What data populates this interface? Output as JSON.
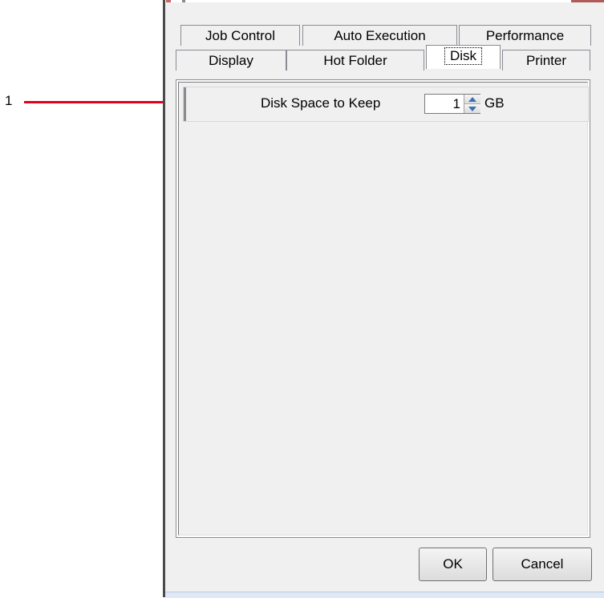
{
  "callout": {
    "number": "1",
    "color": "#e2001a"
  },
  "tabs": {
    "row1": [
      {
        "label": "Job Control"
      },
      {
        "label": "Auto Execution"
      },
      {
        "label": "Performance"
      }
    ],
    "row2": [
      {
        "label": "Display"
      },
      {
        "label": "Hot Folder"
      },
      {
        "label": "Disk",
        "selected": true
      },
      {
        "label": "Printer"
      }
    ]
  },
  "disk_settings": {
    "label": "Disk Space to Keep",
    "value": "1",
    "unit": "GB"
  },
  "buttons": {
    "ok": "OK",
    "cancel": "Cancel"
  }
}
